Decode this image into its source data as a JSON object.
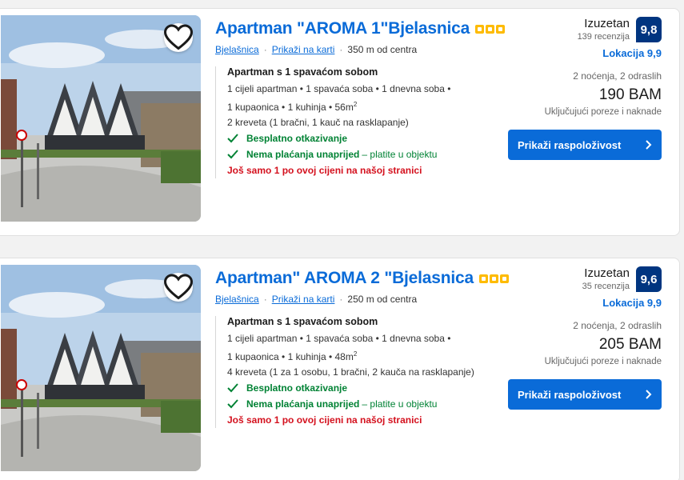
{
  "listings": [
    {
      "title": "Apartman \"AROMA 1\"Bjelasnica",
      "location_link": "Bjelašnica",
      "map_link": "Prikaži na karti",
      "distance": "350 m od centra",
      "room_title": "Apartman s 1 spavaćom sobom",
      "room_line1": "1 cijeli apartman • 1 spavaća soba • 1 dnevna soba •",
      "room_line2_prefix": "1 kupaonica • 1 kuhinja • 56m",
      "room_line2_sup": "2",
      "room_line3": "2 kreveta (1 bračni, 1 kauč na rasklapanje)",
      "benefit1": "Besplatno otkazivanje",
      "benefit2": "Nema plaćanja unaprijed",
      "benefit2_rest": "– platite u objektu",
      "warning": "Još samo 1 po ovoj cijeni na našoj stranici",
      "score_word": "Izuzetan",
      "reviews": "139 recenzija",
      "score": "9,8",
      "location_score": "Lokacija 9,9",
      "stay": "2 noćenja, 2 odraslih",
      "price": "190 BAM",
      "taxes": "Uključujući poreze i naknade",
      "cta": "Prikaži raspoloživost"
    },
    {
      "title": "Apartman\" AROMA 2 \"Bjelasnica",
      "location_link": "Bjelašnica",
      "map_link": "Prikaži na karti",
      "distance": "250 m od centra",
      "room_title": "Apartman s 1 spavaćom sobom",
      "room_line1": "1 cijeli apartman • 1 spavaća soba • 1 dnevna soba •",
      "room_line2_prefix": "1 kupaonica • 1 kuhinja • 48m",
      "room_line2_sup": "2",
      "room_line3": "4 kreveta (1 za 1 osobu, 1 bračni, 2 kauča na rasklapanje)",
      "benefit1": "Besplatno otkazivanje",
      "benefit2": "Nema plaćanja unaprijed",
      "benefit2_rest": "– platite u objektu",
      "warning": "Još samo 1 po ovoj cijeni na našoj stranici",
      "score_word": "Izuzetan",
      "reviews": "35 recenzija",
      "score": "9,6",
      "location_score": "Lokacija 9,9",
      "stay": "2 noćenja, 2 odraslih",
      "price": "205 BAM",
      "taxes": "Uključujući poreze i naknade",
      "cta": "Prikaži raspoloživost"
    }
  ],
  "icons": {
    "favorite": "heart-icon",
    "benefit": "check-icon",
    "cta_arrow": "chevron-right-icon",
    "stars": "square-star-icon"
  },
  "colors": {
    "link": "#0a6bd8",
    "score_badge": "#003580",
    "stars": "#febb02",
    "benefit": "#008234",
    "warning": "#d4111e",
    "cta": "#0a6bd8"
  }
}
